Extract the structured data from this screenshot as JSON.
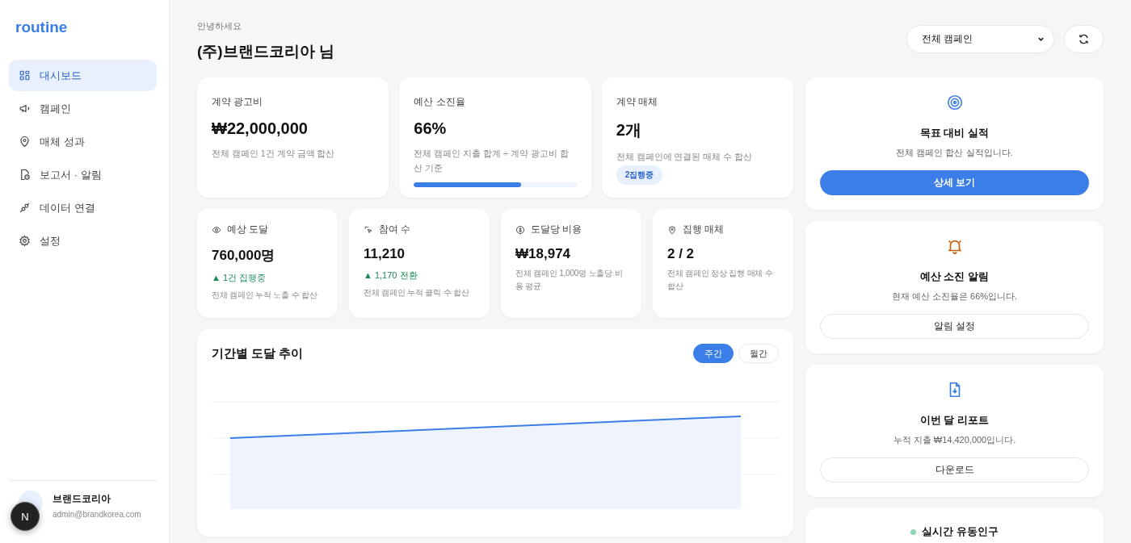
{
  "sidebar": {
    "logo": "routine",
    "items": [
      {
        "label": "대시보드",
        "selected": true
      },
      {
        "label": "캠페인",
        "selected": false
      },
      {
        "label": "매체 성과",
        "selected": false
      },
      {
        "label": "보고서 · 알림",
        "selected": false
      },
      {
        "label": "데이터 연결",
        "selected": false
      },
      {
        "label": "설정",
        "selected": false
      }
    ],
    "user": {
      "name": "브랜드코리아",
      "email": "admin@brandkorea.com"
    },
    "dev_badge": "N"
  },
  "header": {
    "greeting": "안녕하세요",
    "title": "(주)브랜드코리아 님",
    "campaign_select": "전체 캠페인"
  },
  "summary_cards": [
    {
      "label": "계약 광고비",
      "value": "₩22,000,000",
      "note": "전체 캠페인 1건 계약 금액 합산"
    },
    {
      "label": "예산 소진율",
      "value": "66%",
      "note": "전체 캠페인 지출 합계 ÷ 계약 광고비 합산 기준",
      "level": 0.66
    },
    {
      "label": "계약 매체",
      "value": "2개",
      "note": "전체 캠페인에 연결된 매체 수 합산",
      "badge": "2집행중"
    }
  ],
  "metric_cards": [
    {
      "label": "예상 도달",
      "value": "760,000명",
      "trend": "▲ 1건 집행중",
      "note": "전체 캠페인 누적 노출 수 합산"
    },
    {
      "label": "참여 수",
      "value": "11,210",
      "trend": "▲ 1,170 전환",
      "note": "전체 캠페인 누적 클릭 수 합산"
    },
    {
      "label": "도달당 비용",
      "value": "₩18,974",
      "note": "전체 캠페인 1,000명 노출당 비용 평균"
    },
    {
      "label": "집행 매체",
      "value": "2 / 2",
      "note": "전체 캠페인 정상 집행 매체 수 합산"
    }
  ],
  "trend_chart": {
    "title": "기간별 도달 추이",
    "tabs": [
      {
        "label": "주간",
        "selected": true
      },
      {
        "label": "월간",
        "selected": false
      }
    ]
  },
  "side_cards": [
    {
      "title": "목표 대비 실적",
      "text": "전체 캠페인 합산 실적입니다.",
      "button": "상세 보기",
      "kind": "primary"
    },
    {
      "title": "예산 소진 알림",
      "text": "현재 예산 소진율은 66%입니다.",
      "button": "알림 설정",
      "kind": "outline"
    },
    {
      "title": "이번 달 리포트",
      "text": "누적 지출 ₩14,420,000입니다.",
      "button": "다운로드",
      "kind": "outline"
    }
  ],
  "live_card": {
    "title": "실시간 유동인구",
    "color": "#8fd6b8"
  }
}
